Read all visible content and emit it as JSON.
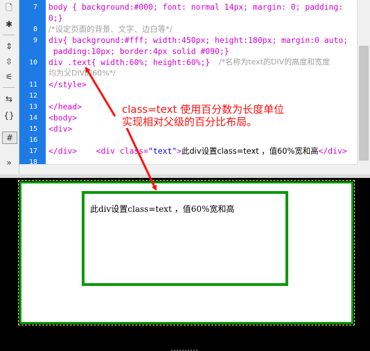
{
  "toolbar": {
    "icons": [
      "document-icon",
      "gear-icon",
      "expand-icon",
      "collapse-icon",
      "split-icon",
      "indent-icon",
      "braces-icon",
      "format-icon",
      "more-icon"
    ],
    "glyphs": [
      "🗋",
      "✱",
      "⇕",
      "⇳",
      "⚟",
      "⇆",
      "{}",
      "#",
      "»"
    ]
  },
  "editor": {
    "line_numbers": [
      "7",
      "8",
      "9",
      "10",
      "11",
      "12",
      "13",
      "14",
      "15",
      "16",
      "17",
      "18"
    ],
    "lines": {
      "l7a": "body { background:#000; font: normal 14px; margin: 0; padding:",
      "l7b": "0;}",
      "l8": "/*设定页面的背景、文字、边白等*/",
      "l9a": "div{ background:#fff; width:450px; height:180px; margin:0 auto;",
      "l9b": " padding:10px; border:4px solid #090;}",
      "l10a": "div .text{ width:60%; height:60%;}",
      "l10b": "/*名称为text的DIV的高度和宽度",
      "l10c": "均为父DIV的60%*/",
      "l11": "</style>",
      "l13": "</head>",
      "l14": "<body>",
      "l15": "<div>",
      "l16_tag": "    <div class=",
      "l16_attr": "\"text\"",
      "l16_close": ">",
      "l16_text": "此div设置class=text ，值60%宽和高",
      "l16_end": "</div>",
      "l17": "</div>"
    }
  },
  "annotation": {
    "line1": "class=text 使用百分数为长度单位",
    "line2": "实现相对父级的百分比布局。",
    "color": "#ff1010"
  },
  "preview": {
    "inner_text": "此div设置class=text ，值60%宽和高",
    "border_color": "#0a9a0a",
    "background": "#000000"
  }
}
